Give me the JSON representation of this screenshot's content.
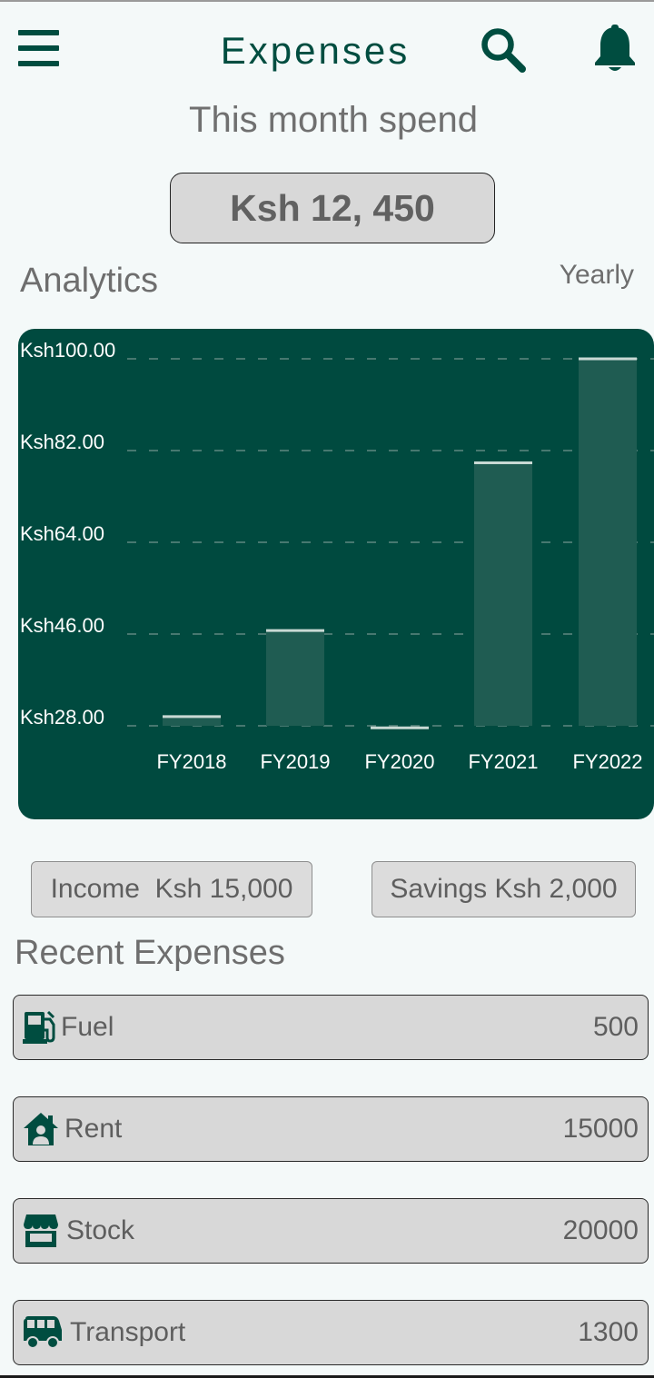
{
  "app": {
    "title": "Expenses"
  },
  "summary": {
    "subtitle": "This month spend",
    "amount": "Ksh 12, 450"
  },
  "analytics": {
    "title": "Analytics",
    "period": "Yearly"
  },
  "chart_data": {
    "type": "bar",
    "categories": [
      "FY2018",
      "FY2019",
      "FY2020",
      "FY2021",
      "FY2022"
    ],
    "values": [
      29.8,
      46.7,
      27.6,
      79.6,
      100.0
    ],
    "ylim": [
      28,
      100
    ],
    "yticks": [
      28,
      46,
      64,
      82,
      100
    ],
    "ytick_labels": [
      "Ksh28.00",
      "Ksh46.00",
      "Ksh64.00",
      "Ksh82.00",
      "Ksh100.00"
    ],
    "grid": true,
    "colors": {
      "background": "#004a3f",
      "bar": "#1f5c52",
      "cap": "#c9d9d4",
      "grid": "#5f8880",
      "text": "#ffffff"
    }
  },
  "totals": {
    "income_label": "Income  Ksh 15,000",
    "savings_label": "Savings Ksh 2,000"
  },
  "recent": {
    "title": "Recent Expenses",
    "items": [
      {
        "label": "Fuel",
        "amount": "500",
        "icon": "gas-station-icon"
      },
      {
        "label": "Rent",
        "amount": "15000",
        "icon": "home-person-icon"
      },
      {
        "label": "Stock",
        "amount": "20000",
        "icon": "store-icon"
      },
      {
        "label": "Transport",
        "amount": "1300",
        "icon": "bus-icon"
      }
    ]
  },
  "colors": {
    "brand": "#004d40",
    "background": "#f4f9f9",
    "pill": "#d8d8d8"
  }
}
